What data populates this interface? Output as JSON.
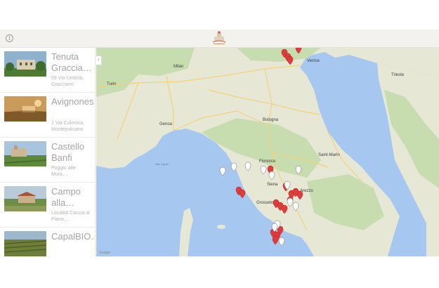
{
  "header": {
    "info_icon": "info-icon",
    "logo_icon": "winery-logo-icon"
  },
  "sidebar": {
    "collapse_icon": "chevron-left-icon",
    "items": [
      {
        "title": "Tenuta Graccia…",
        "address": "59 Via Umbria, Gracciano",
        "thumb_sky": "#8fb1cf",
        "thumb_ground": "#4d7a35",
        "thumb_building": "#d9cdb2"
      },
      {
        "title": "Avignonesi",
        "address": "1 Via Colonica, Montepulciano",
        "thumb_sky": "#c99a5a",
        "thumb_ground": "#8a6230",
        "thumb_building": "#e6c48a"
      },
      {
        "title": "Castello Banfi",
        "address": "Poggio alle Mura,…",
        "thumb_sky": "#a9c4dd",
        "thumb_ground": "#5b8a3a",
        "thumb_building": "#cdb892"
      },
      {
        "title": "Campo alla…",
        "address": "Località Caccia al Piano,…",
        "thumb_sky": "#b9cbd8",
        "thumb_ground": "#6f8e45",
        "thumb_building": "#c7b08a"
      },
      {
        "title": "CapalBIO…",
        "address": "",
        "thumb_sky": "#9db7cc",
        "thumb_ground": "#6e7f3a",
        "thumb_building": "#a98c5c"
      }
    ]
  },
  "map": {
    "colors": {
      "sea": "#a6c8f0",
      "land": "#e6e8d5",
      "green": "#c7ddb0",
      "road": "#f4d27a",
      "marker_red": "#e23b3b",
      "marker_white": "#ffffff"
    },
    "labels": [
      {
        "id": "venice",
        "text": "Venice"
      },
      {
        "id": "turin",
        "text": "Turin"
      },
      {
        "id": "genoa",
        "text": "Genoa"
      },
      {
        "id": "bologna",
        "text": "Bologna"
      },
      {
        "id": "florence",
        "text": "Florence"
      },
      {
        "id": "sanmarino",
        "text": "Saint-Marin"
      },
      {
        "id": "milan",
        "text": "Milan"
      },
      {
        "id": "ligurian",
        "text": "Mar Ligure"
      },
      {
        "id": "grosseto",
        "text": "Grosseto"
      },
      {
        "id": "arezzo",
        "text": "Arezzo"
      },
      {
        "id": "siena",
        "text": "Siena"
      },
      {
        "id": "trieste",
        "text": "Trieste"
      }
    ],
    "attribution": "Google"
  }
}
